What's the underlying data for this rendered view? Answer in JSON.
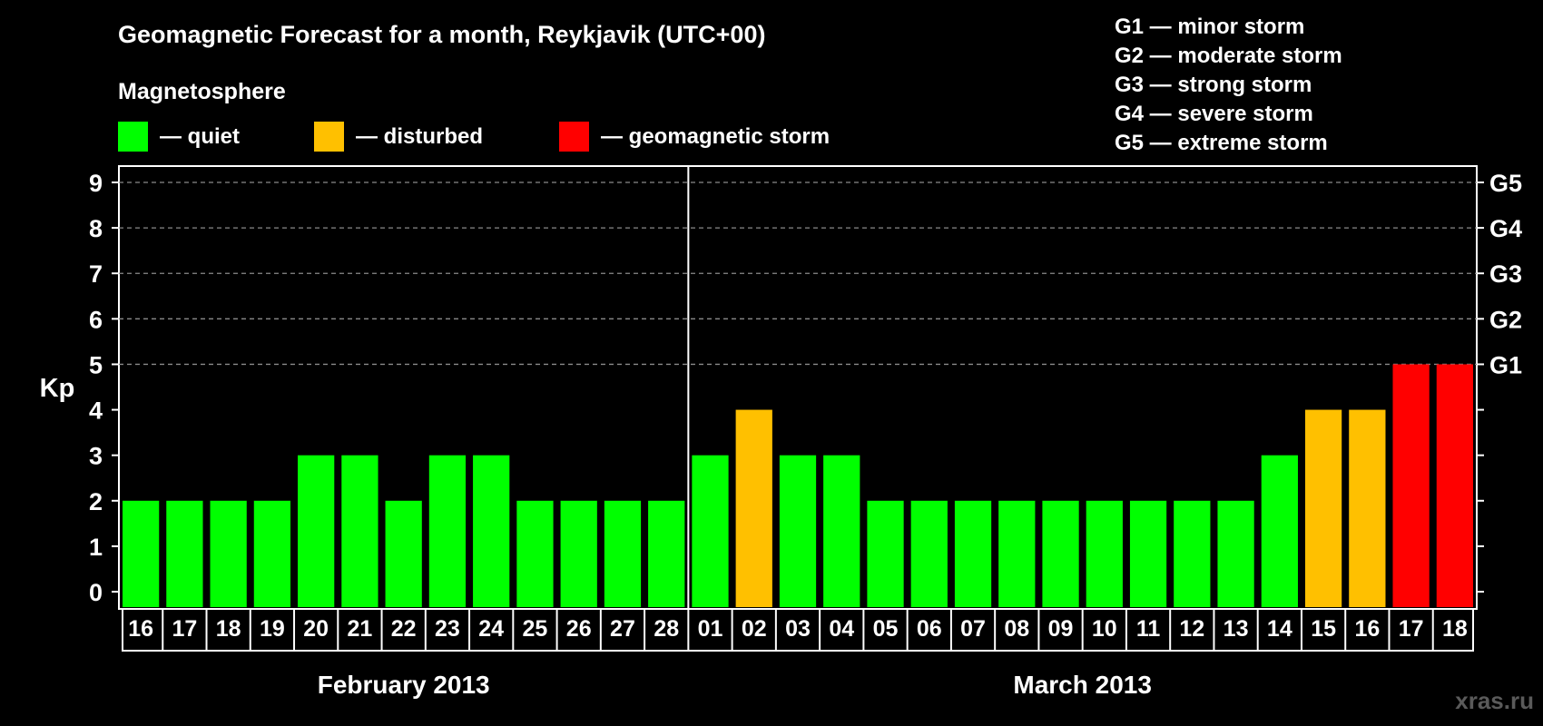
{
  "chart_data": {
    "type": "bar",
    "title": "Geomagnetic Forecast for a month, Reykjavik (UTC+00)",
    "legend_heading": "Magnetosphere",
    "legend": [
      {
        "label": "— quiet",
        "color": "#00ff00"
      },
      {
        "label": "— disturbed",
        "color": "#ffc000"
      },
      {
        "label": "— geomagnetic storm",
        "color": "#ff0000"
      }
    ],
    "storm_scale": [
      "G1 — minor storm",
      "G2 — moderate storm",
      "G3 — strong storm",
      "G4 — severe storm",
      "G5 — extreme storm"
    ],
    "ylabel": "Kp",
    "ylim": [
      0,
      9
    ],
    "yticks": [
      "0",
      "1",
      "2",
      "3",
      "4",
      "5",
      "6",
      "7",
      "8",
      "9"
    ],
    "right_axis": [
      {
        "label": "G1",
        "kp": 5
      },
      {
        "label": "G2",
        "kp": 6
      },
      {
        "label": "G3",
        "kp": 7
      },
      {
        "label": "G4",
        "kp": 8
      },
      {
        "label": "G5",
        "kp": 9
      }
    ],
    "grid": "dashed horizontal lines at Kp 5 to 9",
    "months": [
      {
        "label": "February 2013",
        "days": 13
      },
      {
        "label": "March 2013",
        "days": 18
      }
    ],
    "categories": [
      "16",
      "17",
      "18",
      "19",
      "20",
      "21",
      "22",
      "23",
      "24",
      "25",
      "26",
      "27",
      "28",
      "01",
      "02",
      "03",
      "04",
      "05",
      "06",
      "07",
      "08",
      "09",
      "10",
      "11",
      "12",
      "13",
      "14",
      "15",
      "16",
      "17",
      "18"
    ],
    "values": [
      2,
      2,
      2,
      2,
      3,
      3,
      2,
      3,
      3,
      2,
      2,
      2,
      2,
      3,
      4,
      3,
      3,
      2,
      2,
      2,
      2,
      2,
      2,
      2,
      2,
      2,
      3,
      4,
      4,
      5,
      5
    ],
    "colors": {
      "quiet": "#00ff00",
      "disturbed": "#ffc000",
      "storm": "#ff0000"
    },
    "watermark": "xras.ru"
  }
}
